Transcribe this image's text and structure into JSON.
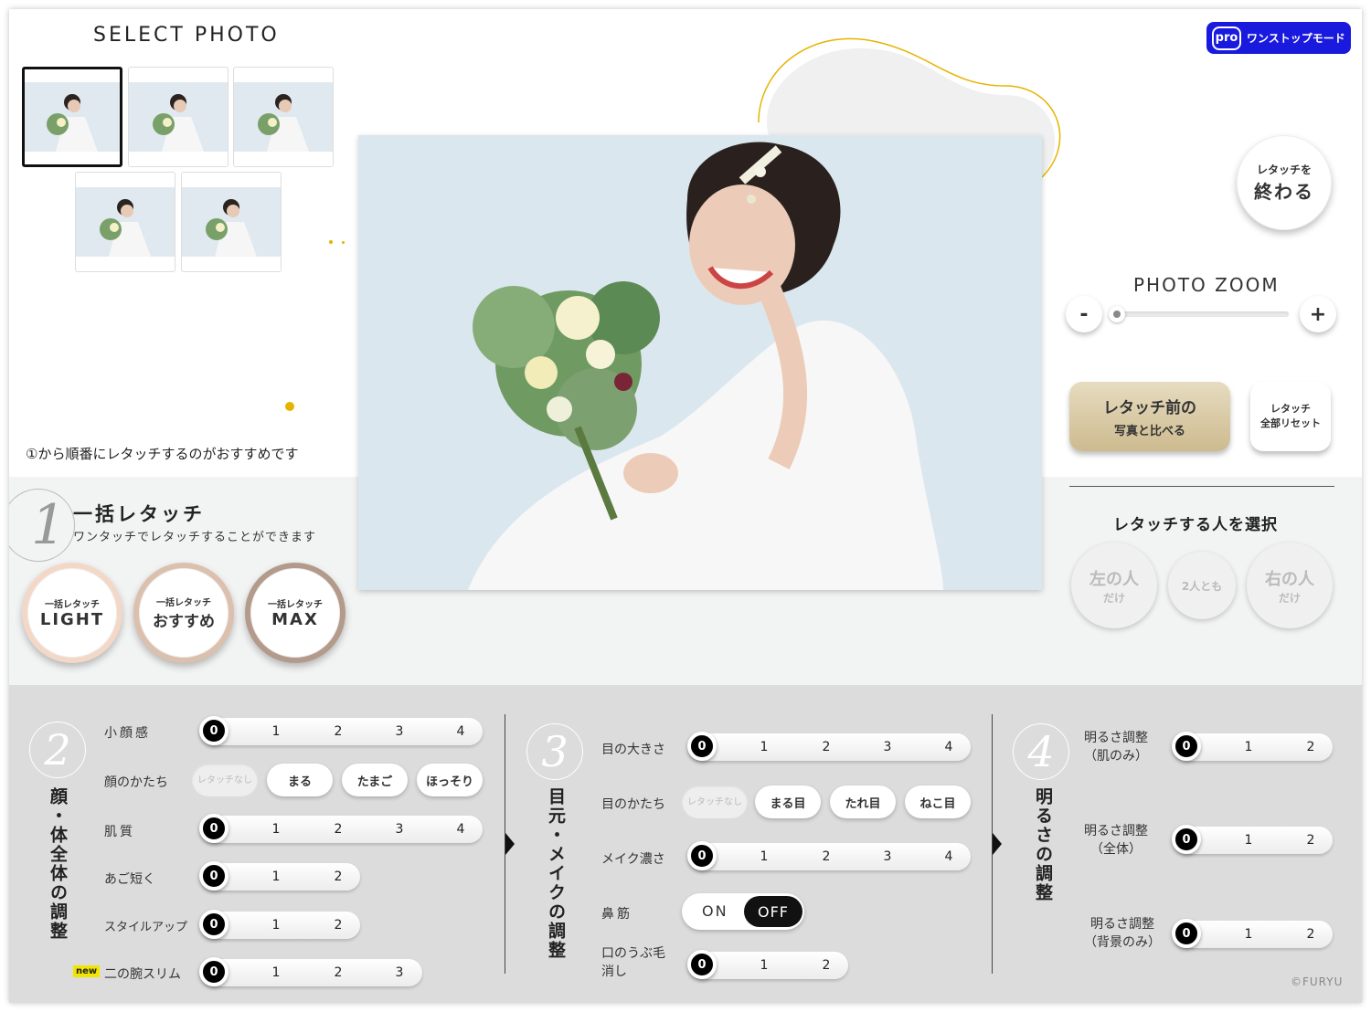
{
  "header": {
    "select_photo": "SELECT PHOTO",
    "pro_badge": "pro",
    "pro_mode": "ワンストップモード"
  },
  "thumbnails": [
    "photo-1",
    "photo-2",
    "photo-3",
    "photo-4",
    "photo-5"
  ],
  "hint": "①から順番にレタッチするのがおすすめです",
  "finish": {
    "line1": "レタッチを",
    "line2": "終わる"
  },
  "zoom": {
    "title": "PHOTO ZOOM",
    "minus": "-",
    "plus": "+",
    "level": 0
  },
  "compare": {
    "line1": "レタッチ前の",
    "line2": "写真と比べる"
  },
  "reset": {
    "line1": "レタッチ",
    "line2": "全部リセット"
  },
  "person_select": {
    "title": "レタッチする人を選択",
    "left": "左の人",
    "left_sub": "だけ",
    "both": "2人とも",
    "right": "右の人",
    "right_sub": "だけ"
  },
  "bulk": {
    "number": "1",
    "title": "一括レタッチ",
    "subtitle": "ワンタッチでレタッチすることができます",
    "buttons": [
      {
        "top": "一括レタッチ",
        "label": "LIGHT"
      },
      {
        "top": "一括レタッチ",
        "label": "おすすめ"
      },
      {
        "top": "一括レタッチ",
        "label": "MAX"
      }
    ]
  },
  "section2": {
    "number": "2",
    "title": "顔・体全体の調整",
    "face_size": {
      "label": "小顔感",
      "ticks": [
        "0",
        "1",
        "2",
        "3",
        "4"
      ],
      "value": 0
    },
    "face_shape": {
      "label": "顔のかたち",
      "options": [
        "レタッチなし",
        "まる",
        "たまご",
        "ほっそり"
      ]
    },
    "skin": {
      "label": "肌質",
      "ticks": [
        "0",
        "1",
        "2",
        "3",
        "4"
      ],
      "value": 0
    },
    "chin": {
      "label": "あご短く",
      "ticks": [
        "0",
        "1",
        "2"
      ],
      "value": 0
    },
    "style": {
      "label": "スタイルアップ",
      "ticks": [
        "0",
        "1",
        "2"
      ],
      "value": 0
    },
    "arm": {
      "label": "二の腕スリム",
      "badge": "new",
      "ticks": [
        "0",
        "1",
        "2",
        "3"
      ],
      "value": 0
    }
  },
  "section3": {
    "number": "3",
    "title": "目元・メイクの調整",
    "eye_size": {
      "label": "目の大きさ",
      "ticks": [
        "0",
        "1",
        "2",
        "3",
        "4"
      ],
      "value": 0
    },
    "eye_shape": {
      "label": "目のかたち",
      "options": [
        "レタッチなし",
        "まる目",
        "たれ目",
        "ねこ目"
      ]
    },
    "makeup": {
      "label": "メイク濃さ",
      "ticks": [
        "0",
        "1",
        "2",
        "3",
        "4"
      ],
      "value": 0
    },
    "nose": {
      "label": "鼻筋",
      "on": "ON",
      "off": "OFF",
      "state": "OFF"
    },
    "mouth_hair": {
      "label1": "口のうぶ毛",
      "label2": "消し",
      "ticks": [
        "0",
        "1",
        "2"
      ],
      "value": 0
    }
  },
  "section4": {
    "number": "4",
    "title": "明るさの調整",
    "skin_bright": {
      "label1": "明るさ調整",
      "label2": "（肌のみ）",
      "ticks": [
        "0",
        "1",
        "2"
      ],
      "value": 0
    },
    "all_bright": {
      "label1": "明るさ調整",
      "label2": "（全体）",
      "ticks": [
        "0",
        "1",
        "2"
      ],
      "value": 0
    },
    "bg_bright": {
      "label1": "明るさ調整",
      "label2": "（背景のみ）",
      "ticks": [
        "0",
        "1",
        "2"
      ],
      "value": 0
    }
  },
  "copyright": "©FURYU",
  "colors": {
    "pro": "#1a1adf",
    "accent": "#e5b400",
    "compare": "#cdbb8f"
  }
}
